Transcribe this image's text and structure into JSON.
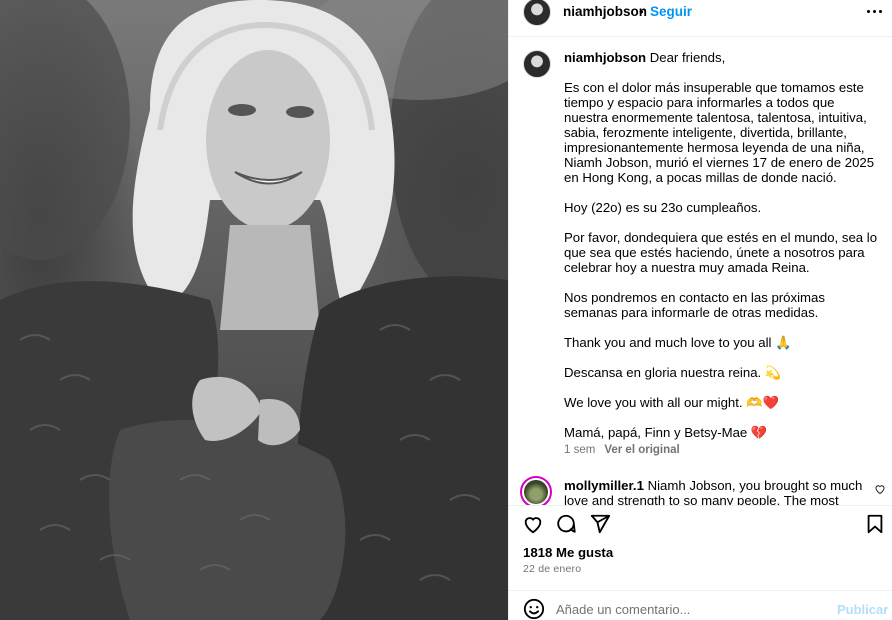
{
  "post": {
    "username": "niamhjobson",
    "follow_label": "Seguir",
    "separator": "•"
  },
  "caption": {
    "username": "niamhjobson",
    "first_line": "Dear friends,",
    "paragraphs": [
      "Es con el dolor más insuperable que tomamos este tiempo y espacio para informarles a todos que nuestra enormemente talentosa, talentosa, intuitiva, sabia, ferozmente inteligente, divertida, brillante, impresionantemente hermosa leyenda de una niña, Niamh Jobson, murió el viernes 17 de enero de 2025 en Hong Kong, a pocas millas de donde nació.",
      "Hoy (22o) es su 23o cumpleaños.",
      "Por favor, dondequiera que estés en el mundo, sea lo que sea que estés haciendo, únete a nosotros para celebrar hoy a nuestra muy amada Reina.",
      "Nos pondremos en contacto en las próximas semanas para informarle de otras medidas.",
      "Thank you and much love to you all 🙏",
      "Descansa en gloria nuestra reina. 💫",
      "We love you with all our might. 🫶❤️",
      "Mamá, papá, Finn y Betsy-Mae 💔"
    ],
    "age": "1 sem",
    "see_original": "Ver el original"
  },
  "comment": {
    "username": "mollymiller.1",
    "text": "Niamh Jobson, you brought so much love and strength to so many people. The most iconic"
  },
  "stats": {
    "likes": "1818 Me gusta",
    "date": "22 de enero"
  },
  "composer": {
    "placeholder": "Añade un comentario...",
    "publish_label": "Publicar"
  },
  "colors": {
    "accent": "#0095f6",
    "muted": "#737373",
    "publish_disabled": "#b2dffc",
    "story_ring": "#d300c5"
  },
  "icons": [
    "more-options-icon",
    "like-icon",
    "comment-icon",
    "share-icon",
    "save-icon",
    "emoji-icon",
    "comment-like-icon"
  ]
}
